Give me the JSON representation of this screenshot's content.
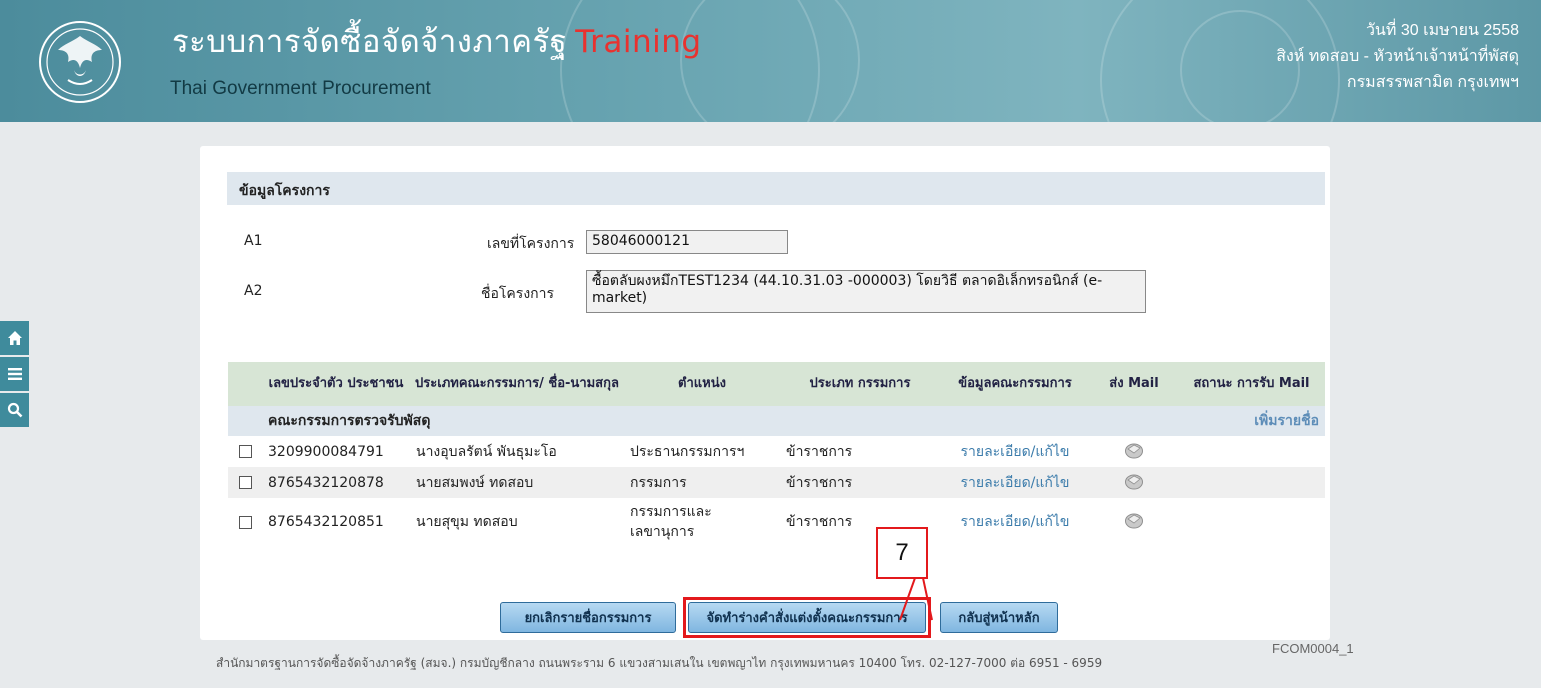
{
  "header": {
    "title": "ระบบการจัดซื้อจัดจ้างภาครัฐ",
    "title_suffix": "Training",
    "subtitle": "Thai Government Procurement",
    "date": "วันที่ 30 เมษายน 2558",
    "user": "สิงห์ ทดสอบ - หัวหน้าเจ้าหน้าที่พัสดุ",
    "department": "กรมสรรพสามิต กรุงเทพฯ"
  },
  "sidebar": {
    "icons": [
      "home-icon",
      "menu-icon",
      "search-icon"
    ]
  },
  "project": {
    "section_title": "ข้อมูลโครงการ",
    "rows": [
      {
        "code": "A1",
        "label": "เลขที่โครงการ",
        "value": "58046000121"
      },
      {
        "code": "A2",
        "label": "ชื่อโครงการ",
        "value": "ซื้อตลับผงหมึกTEST1234 (44.10.31.03 -000003) โดยวิธี ตลาดอิเล็กทรอนิกส์ (e-market)"
      }
    ]
  },
  "table": {
    "headers": [
      "",
      "เลขประจำตัว ประชาชน",
      "ประเภทคณะกรรมการ/ ชื่อ-นามสกุล",
      "ตำแหน่ง",
      "ประเภท กรรมการ",
      "ข้อมูลคณะกรรมการ",
      "ส่ง Mail",
      "สถานะ การรับ Mail"
    ],
    "group_title": "คณะกรรมการตรวจรับพัสดุ",
    "add_link": "เพิ่มรายชื่อ",
    "rows": [
      {
        "id": "3209900084791",
        "name": "นางอุบลรัตน์ พันธุมะโอ",
        "position": "ประธานกรรมการฯ",
        "type": "ข้าราชการ",
        "link": "รายละเอียด/แก้ไข"
      },
      {
        "id": "8765432120878",
        "name": "นายสมพงษ์ ทดสอบ",
        "position": "กรรมการ",
        "type": "ข้าราชการ",
        "link": "รายละเอียด/แก้ไข"
      },
      {
        "id": "8765432120851",
        "name": "นายสุขุม ทดสอบ",
        "position": "กรรมการและ เลขานุการ",
        "type": "ข้าราชการ",
        "link": "รายละเอียด/แก้ไข"
      }
    ]
  },
  "buttons": {
    "cancel": "ยกเลิกรายชื่อกรรมการ",
    "draft": "จัดทำร่างคำสั่งแต่งตั้งคณะกรรมการ",
    "back": "กลับสู่หน้าหลัก"
  },
  "callout": {
    "number": "7"
  },
  "footer": {
    "form_code": "FCOM0004_1",
    "text": "สำนักมาตรฐานการจัดซื้อจัดจ้างภาครัฐ (สมจ.) กรมบัญชีกลาง ถนนพระราม 6 แขวงสามเสนใน เขตพญาไท กรุงเทพมหานคร 10400 โทร. 02-127-7000 ต่อ 6951 - 6959"
  },
  "colors": {
    "header_bg": "#5d98a6",
    "training_red": "#e8322f",
    "table_header_bg": "#d7e5d5",
    "link_blue": "#3c7cab",
    "callout_red": "#e3191c"
  }
}
